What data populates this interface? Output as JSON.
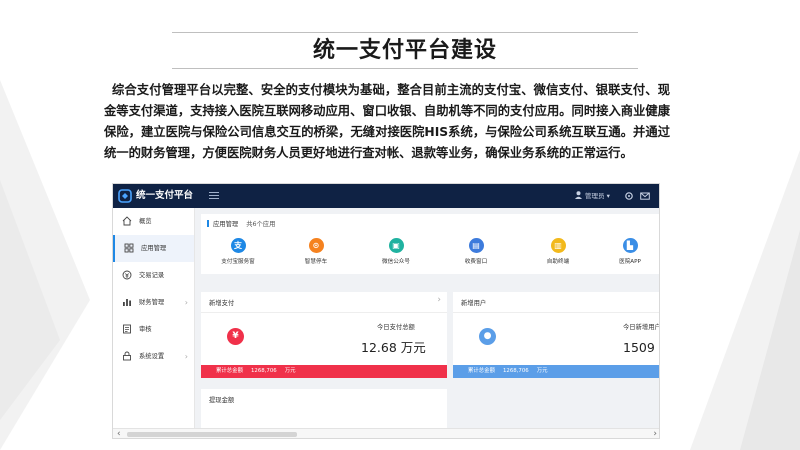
{
  "slide": {
    "title": "统一支付平台建设",
    "intro": "综合支付管理平台以完整、安全的支付模块为基础，整合目前主流的支付宝、微信支付、银联支付、现金等支付渠道，支持接入医院互联网移动应用、窗口收银、自助机等不同的支付应用。同时接入商业健康保险，建立医院与保险公司信息交互的桥梁，无缝对接医院HIS系统，与保险公司系统互联互通。并通过统一的财务管理，方便医院财务人员更好地进行查对帐、退款等业务，确保业务系统的正常运行。"
  },
  "app": {
    "title": "统一支付平台",
    "user": "管理员",
    "user_caret": "▾",
    "sidebar": [
      {
        "label": "概览",
        "icon": "home-icon",
        "active": false
      },
      {
        "label": "应用管理",
        "icon": "apps-grid-icon",
        "active": true
      },
      {
        "label": "交易记录",
        "icon": "transaction-icon",
        "active": false
      },
      {
        "label": "财务管理",
        "icon": "finance-chart-icon",
        "active": false,
        "chevron": "›"
      },
      {
        "label": "审核",
        "icon": "audit-icon",
        "active": false
      },
      {
        "label": "系统设置",
        "icon": "settings-icon",
        "active": false,
        "chevron": "›"
      }
    ],
    "apps_header": {
      "label": "应用管理",
      "count": "共6个应用"
    },
    "apps": [
      {
        "label": "支付宝服务窗",
        "glyph": "支",
        "color": "#1e88e5",
        "icon": "alipay-icon"
      },
      {
        "label": "智慧停车",
        "glyph": "⊙",
        "color": "#f5821f",
        "icon": "parking-icon"
      },
      {
        "label": "微信公众号",
        "glyph": "▣",
        "color": "#20b2a0",
        "icon": "wechat-icon"
      },
      {
        "label": "收费窗口",
        "glyph": "▤",
        "color": "#3d7bdc",
        "icon": "counter-icon"
      },
      {
        "label": "自助终端",
        "glyph": "▥",
        "color": "#f2b91c",
        "icon": "kiosk-icon"
      },
      {
        "label": "医院APP",
        "glyph": "▙",
        "color": "#3a8ee6",
        "icon": "hospital-app-icon"
      }
    ],
    "new_payment": {
      "title": "新增支付",
      "chevron": "›",
      "label": "今日支付总额",
      "value": "12.68 万元",
      "glyph": "¥",
      "footer_label": "累计总金额",
      "footer_value": "1268,706",
      "footer_unit": "万元",
      "color": "#f0314a"
    },
    "new_users": {
      "title": "新增用户",
      "label": "今日新增用户",
      "value": "1509 个",
      "glyph": "●",
      "footer_label": "累计总金额",
      "footer_value": "1268,706",
      "footer_unit": "万元",
      "color": "#5b9ee8"
    },
    "withdraw": {
      "title": "提现金额"
    },
    "scroll_left": "‹",
    "scroll_right": "›"
  }
}
